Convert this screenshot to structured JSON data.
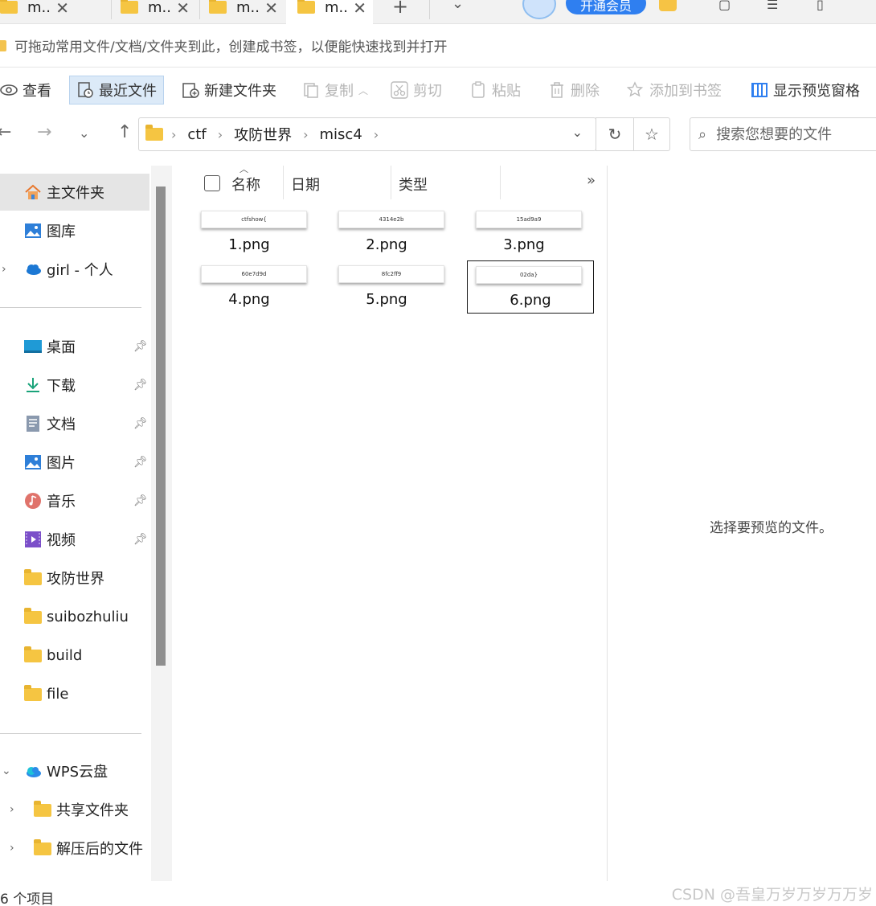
{
  "tabs": [
    {
      "label": "m..",
      "close": "✕",
      "active": false
    },
    {
      "label": "m..",
      "close": "✕",
      "active": false
    },
    {
      "label": "m..",
      "close": "✕",
      "active": false
    },
    {
      "label": "m..",
      "close": "✕",
      "active": true
    }
  ],
  "tabbar": {
    "new_tab": "+",
    "tab_list": "⌄",
    "vip_label": "开通会员"
  },
  "bookmark_bar": {
    "hint": "可拖动常用文件/文档/文件夹到此，创建成书签，以便能快速找到并打开"
  },
  "toolbar": {
    "view": "查看",
    "recent": "最近文件",
    "new_folder": "新建文件夹",
    "copy": "复制",
    "cut": "剪切",
    "paste": "粘贴",
    "delete": "删除",
    "add_bookmark": "添加到书签",
    "show_preview": "显示预览窗格"
  },
  "address": {
    "crumbs": [
      "ctf",
      "攻防世界",
      "misc4"
    ],
    "search_placeholder": "搜索您想要的文件"
  },
  "sidebar": {
    "items": [
      {
        "label": "主文件夹",
        "icon": "home-icon",
        "active": true
      },
      {
        "label": "图库",
        "icon": "gallery-icon"
      },
      {
        "label": "girl - 个人",
        "icon": "onedrive-cloud-icon"
      },
      {
        "label": "桌面",
        "icon": "desktop-icon",
        "pinned": true
      },
      {
        "label": "下载",
        "icon": "download-icon",
        "pinned": true
      },
      {
        "label": "文档",
        "icon": "document-icon",
        "pinned": true
      },
      {
        "label": "图片",
        "icon": "pictures-icon",
        "pinned": true
      },
      {
        "label": "音乐",
        "icon": "music-icon",
        "pinned": true
      },
      {
        "label": "视频",
        "icon": "video-icon",
        "pinned": true
      },
      {
        "label": "攻防世界",
        "icon": "folder-icon"
      },
      {
        "label": "suibozhuliu",
        "icon": "folder-icon"
      },
      {
        "label": "build",
        "icon": "folder-icon"
      },
      {
        "label": "file",
        "icon": "folder-icon"
      },
      {
        "label": "WPS云盘",
        "icon": "wps-cloud-icon"
      },
      {
        "label": "共享文件夹",
        "icon": "shared-folder-icon"
      },
      {
        "label": "解压后的文件",
        "icon": "folder-icon"
      }
    ]
  },
  "columns": {
    "name": "名称",
    "date": "日期",
    "type": "类型",
    "more": "»"
  },
  "files": [
    {
      "name": "1.png",
      "thumb_text": "ctfshow{"
    },
    {
      "name": "2.png",
      "thumb_text": "4314e2b"
    },
    {
      "name": "3.png",
      "thumb_text": "15ad9a9"
    },
    {
      "name": "4.png",
      "thumb_text": "60e7d9d"
    },
    {
      "name": "5.png",
      "thumb_text": "8fc2ff9"
    },
    {
      "name": "6.png",
      "thumb_text": "02da}",
      "selected": true
    }
  ],
  "preview": {
    "text": "选择要预览的文件。"
  },
  "status": {
    "count": "6 个项目",
    "watermark": "CSDN @吾皇万岁万岁万万岁"
  },
  "colors": {
    "accent": "#2f7ff0",
    "folder": "#f5c542",
    "selected_bg": "#e5e5e5"
  }
}
